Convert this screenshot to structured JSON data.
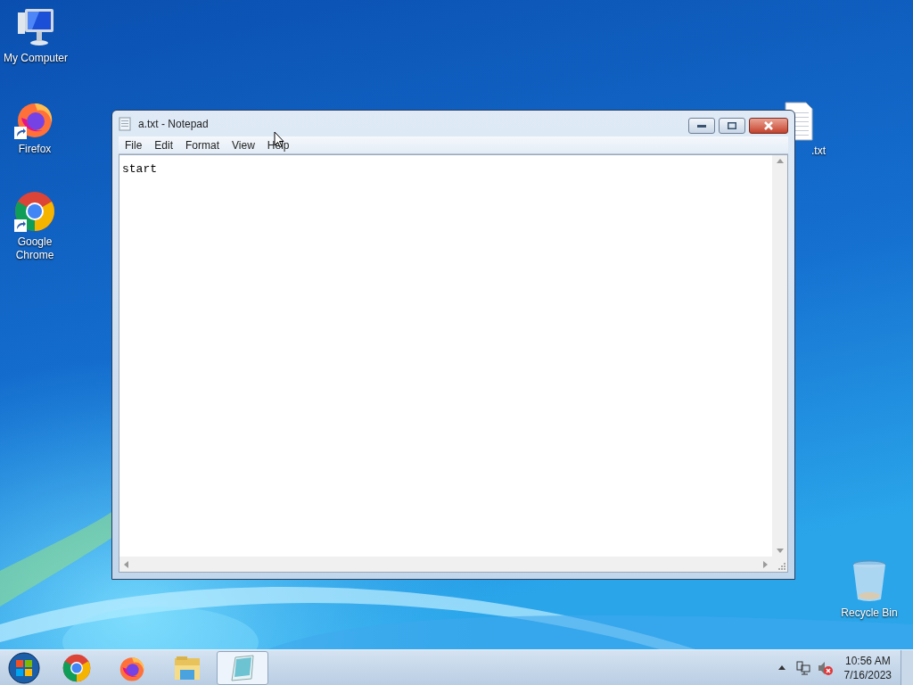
{
  "desktop_icons": [
    {
      "kind": "computer",
      "label": "My Computer"
    },
    {
      "kind": "firefox",
      "label": "Firefox"
    },
    {
      "kind": "chrome",
      "label": "Google Chrome"
    },
    {
      "kind": "textfile",
      "label": ".txt"
    },
    {
      "kind": "recycle",
      "label": "Recycle Bin"
    }
  ],
  "window": {
    "title": "a.txt - Notepad",
    "menu": [
      "File",
      "Edit",
      "Format",
      "View",
      "Help"
    ],
    "content": "start"
  },
  "taskbar": {
    "items": [
      {
        "kind": "chrome",
        "selected": false
      },
      {
        "kind": "firefox",
        "selected": false
      },
      {
        "kind": "explorer",
        "selected": false
      },
      {
        "kind": "notepad",
        "selected": true
      }
    ],
    "time": "10:56 AM",
    "date": "7/16/2023"
  }
}
